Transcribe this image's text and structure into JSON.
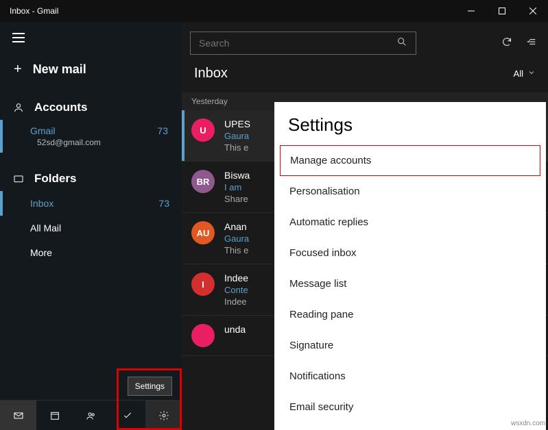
{
  "window": {
    "title": "Inbox - Gmail"
  },
  "sidebar": {
    "newmail": "New mail",
    "accounts_label": "Accounts",
    "account": {
      "name": "Gmail",
      "count": "73",
      "email": "52sd@gmail.com"
    },
    "folders_label": "Folders",
    "folders": [
      {
        "name": "Inbox",
        "count": "73"
      },
      {
        "name": "All Mail",
        "count": ""
      },
      {
        "name": "More",
        "count": ""
      }
    ],
    "settings_tooltip": "Settings"
  },
  "search": {
    "placeholder": "Search"
  },
  "inbox": {
    "title": "Inbox",
    "filter": "All",
    "date_group": "Yesterday",
    "messages": [
      {
        "avatar": "U",
        "color": "#e91e63",
        "from": "UPES",
        "subject": "Gaura",
        "preview": "This e",
        "selected": true,
        "dots": true
      },
      {
        "avatar": "BR",
        "color": "#8e5a8e",
        "from": "Biswa",
        "subject": "I am",
        "preview": "Share"
      },
      {
        "avatar": "AU",
        "color": "#e25822",
        "from": "Anan",
        "subject": "Gaura",
        "preview": "This e"
      },
      {
        "avatar": "I",
        "color": "#d32f2f",
        "from": "Indee",
        "subject": "Conte",
        "preview": "Indee"
      },
      {
        "avatar": "",
        "color": "#e91e63",
        "from": "unda",
        "subject": "",
        "preview": ""
      }
    ]
  },
  "settings": {
    "title": "Settings",
    "items": [
      "Manage accounts",
      "Personalisation",
      "Automatic replies",
      "Focused inbox",
      "Message list",
      "Reading pane",
      "Signature",
      "Notifications",
      "Email security"
    ]
  },
  "watermark": "wsxdn.com"
}
